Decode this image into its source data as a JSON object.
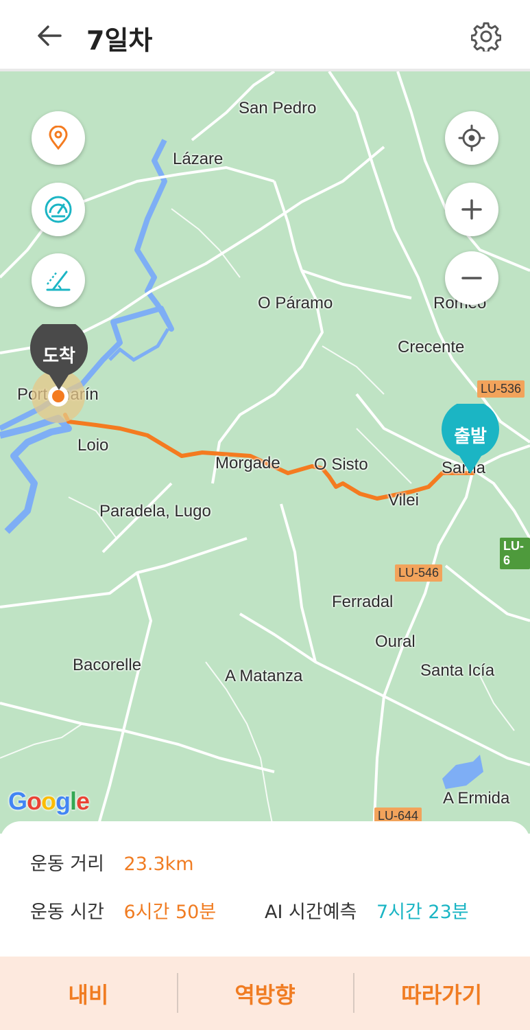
{
  "header": {
    "title": "7일차",
    "back_icon": "arrow-left-icon",
    "settings_icon": "gear-icon"
  },
  "map": {
    "places": [
      {
        "id": "san-pedro",
        "name": "San Pedro"
      },
      {
        "id": "lazare",
        "name": "Lázare"
      },
      {
        "id": "o-paramo",
        "name": "O Páramo"
      },
      {
        "id": "romeo",
        "name": "Romeo"
      },
      {
        "id": "crecente",
        "name": "Crecente"
      },
      {
        "id": "portomarin",
        "name": "Portomarín"
      },
      {
        "id": "loio",
        "name": "Loio"
      },
      {
        "id": "morgade",
        "name": "Morgade"
      },
      {
        "id": "o-sisto",
        "name": "O Sisto"
      },
      {
        "id": "sarria",
        "name": "Sarria"
      },
      {
        "id": "vilei",
        "name": "Vilei"
      },
      {
        "id": "paradela",
        "name": "Paradela, Lugo"
      },
      {
        "id": "ferradal",
        "name": "Ferradal"
      },
      {
        "id": "oural",
        "name": "Oural"
      },
      {
        "id": "bacorelle",
        "name": "Bacorelle"
      },
      {
        "id": "a-matanza",
        "name": "A Matanza"
      },
      {
        "id": "santa-icia",
        "name": "Santa Icía"
      },
      {
        "id": "a-ermida",
        "name": "A Ermida"
      }
    ],
    "roads": [
      {
        "id": "lu-536",
        "label": "LU-536"
      },
      {
        "id": "lu-546",
        "label": "LU-546"
      },
      {
        "id": "lu-644",
        "label": "LU-644"
      },
      {
        "id": "lu-6",
        "label": "LU-6"
      }
    ],
    "pins": {
      "start_label": "출발",
      "end_label": "도착"
    },
    "left_controls": [
      "location-pin-icon",
      "speedometer-icon",
      "slope-icon"
    ],
    "right_controls": [
      "my-location-icon",
      "zoom-in-icon",
      "zoom-out-icon"
    ],
    "attribution": "Google",
    "colors": {
      "route": "#f47b20",
      "start_pin": "#1bb5c4",
      "end_pin": "#4a4a4a",
      "land": "#bfe3c4",
      "water": "#7eaef5"
    }
  },
  "stats": {
    "distance_label": "운동 거리",
    "distance_value": "23.3km",
    "time_label": "운동 시간",
    "time_value": "6시간 50분",
    "ai_label": "AI 시간예측",
    "ai_value": "7시간 23분"
  },
  "bottom_actions": {
    "nav": "내비",
    "reverse": "역방향",
    "follow": "따라가기"
  }
}
